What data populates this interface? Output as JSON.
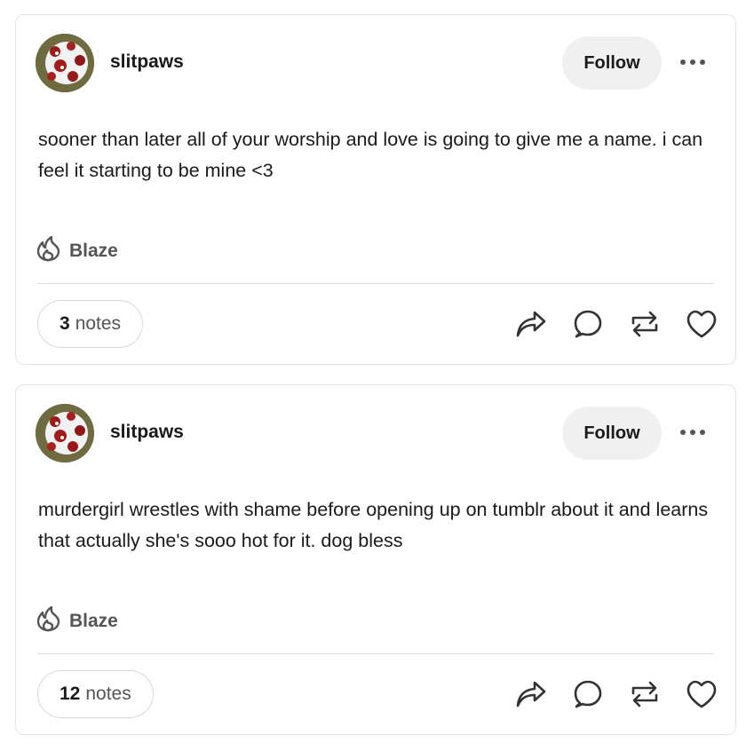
{
  "colors": {
    "text": "#1a1a1a",
    "muted": "#555555",
    "border": "#e3e3e3",
    "follow_bg": "#f0f0f0"
  },
  "posts": [
    {
      "username": "slitpaws",
      "follow_label": "Follow",
      "body": "sooner than later all of your worship and love is going to give me a name. i can feel it starting to be mine <3",
      "blaze_label": "Blaze",
      "notes_count": "3",
      "notes_label": "notes"
    },
    {
      "username": "slitpaws",
      "follow_label": "Follow",
      "body": "murdergirl wrestles with shame before opening up on tumblr about it and learns that actually she's sooo hot for it. dog bless",
      "blaze_label": "Blaze",
      "notes_count": "12",
      "notes_label": "notes"
    }
  ],
  "icons": [
    "avatar-image",
    "more-options-icon",
    "blaze-flame-icon",
    "share-icon",
    "reply-icon",
    "reblog-icon",
    "like-heart-icon"
  ]
}
